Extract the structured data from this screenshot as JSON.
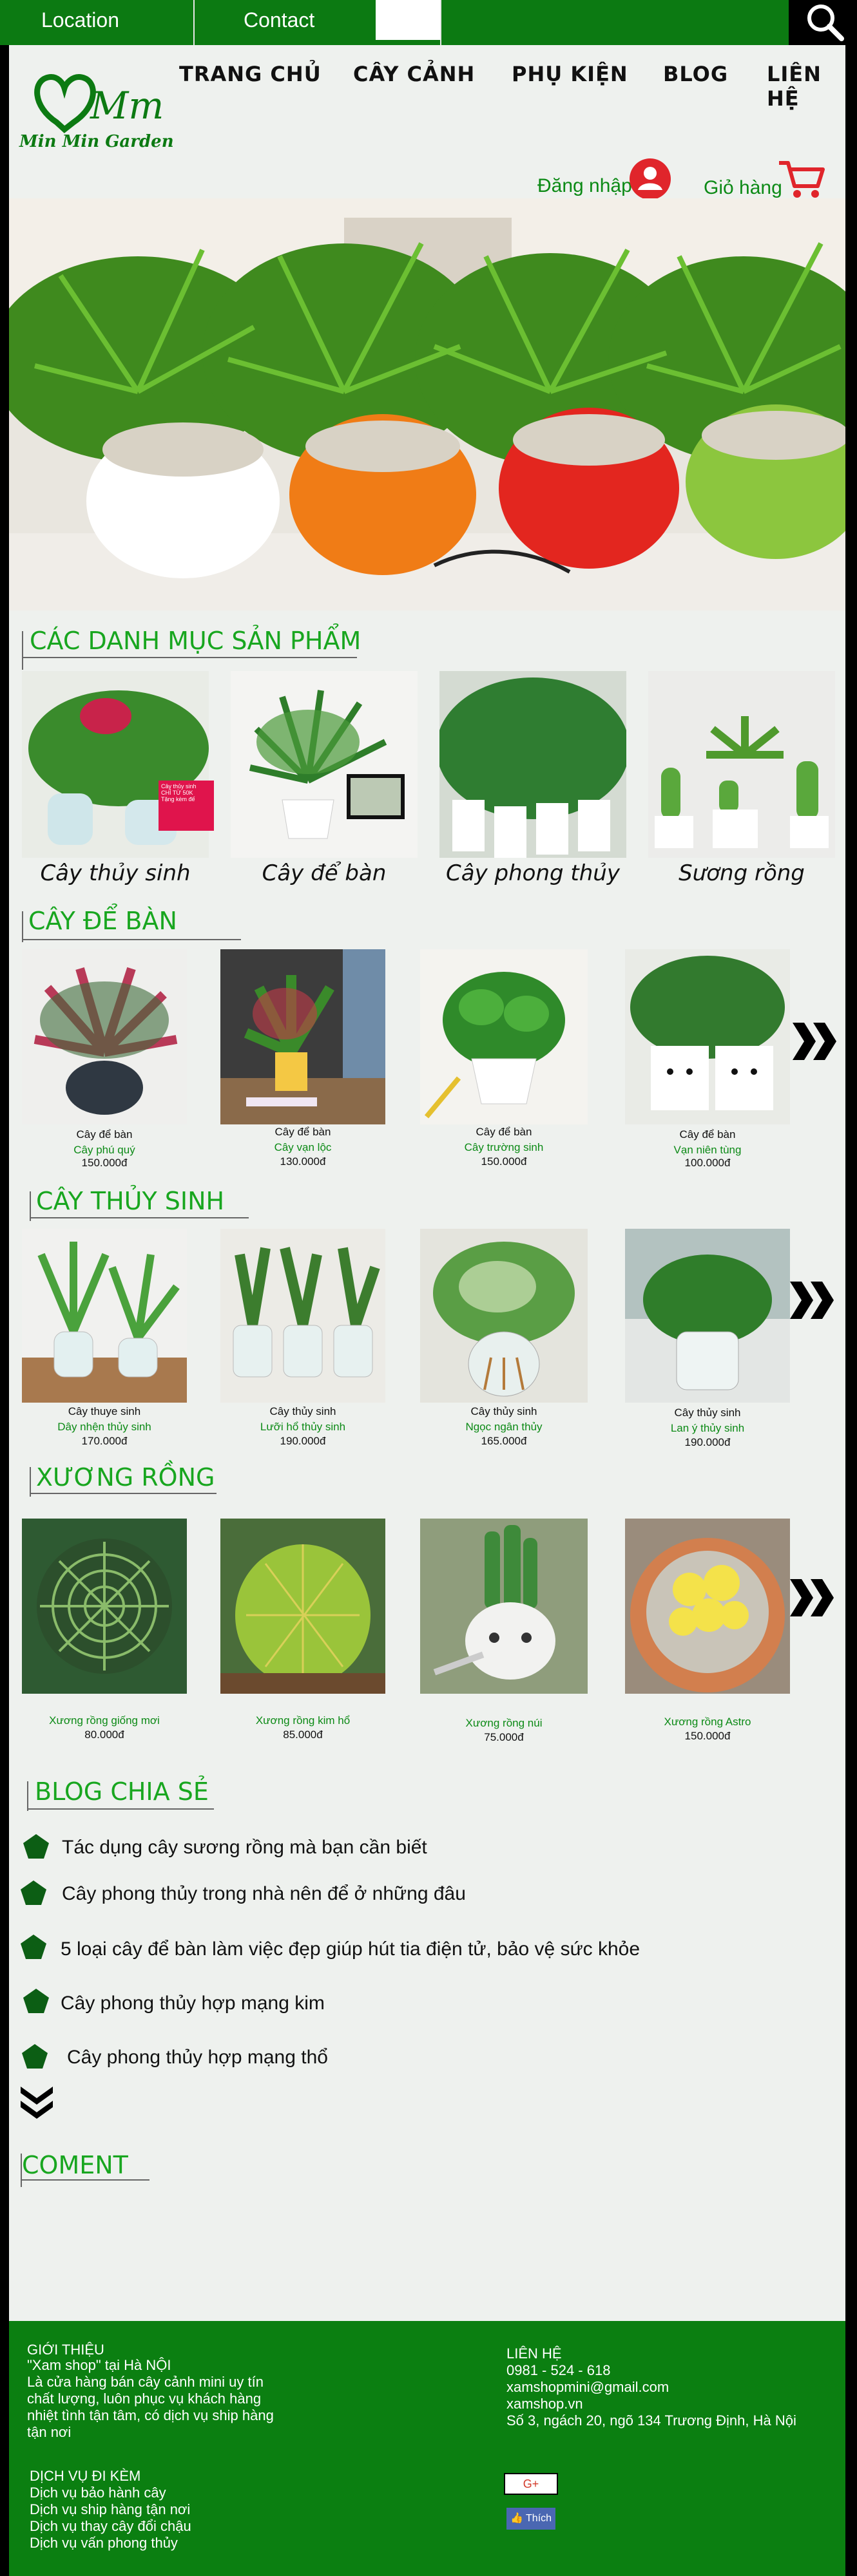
{
  "topbar": {
    "location_label": "Location",
    "contact_label": "Contact"
  },
  "brand": {
    "logo_mark": "Mm",
    "logo_text": "Min Min Garden"
  },
  "nav": {
    "home": "TRANG CHỦ",
    "plants": "CÂY CẢNH",
    "accessories": "PHỤ KIỆN",
    "blog": "BLOG",
    "contact": "LIÊN HỆ"
  },
  "user": {
    "login_label": "Đăng nhập",
    "cart_label": "Giỏ hàng"
  },
  "categories": {
    "title": "CÁC DANH MỤC SẢN PHẨM",
    "items": [
      {
        "label": "Cây thủy sinh",
        "badge": "Cây thủy sinh\nCHỈ TỪ 50K\nTặng kèm đế"
      },
      {
        "label": "Cây để bàn"
      },
      {
        "label": "Cây phong thủy"
      },
      {
        "label": "Sương rồng"
      }
    ]
  },
  "desk": {
    "title": "CÂY ĐỂ BÀN",
    "items": [
      {
        "type": "Cây để bàn",
        "name": "Cây phú quý",
        "price": "150.000đ"
      },
      {
        "type": "Cây để bàn",
        "name": "Cây vạn lộc",
        "price": "130.000đ"
      },
      {
        "type": "Cây để bàn",
        "name": "Cây trường sinh",
        "price": "150.000đ"
      },
      {
        "type": "Cây để bàn",
        "name": "Vạn niên tùng",
        "price": "100.000đ"
      }
    ]
  },
  "aquatic": {
    "title": "CÂY THỦY SINH",
    "items": [
      {
        "type": "Cây thuye sinh",
        "name": "Dây nhện thủy sinh",
        "price": "170.000đ"
      },
      {
        "type": "Cây thủy sinh",
        "name": "Lưỡi hổ thủy sinh",
        "price": "190.000đ"
      },
      {
        "type": "Cây thủy sinh",
        "name": "Ngọc ngân thủy",
        "price": "165.000đ"
      },
      {
        "type": "Cây thủy sinh",
        "name": "Lan ý thủy sinh",
        "price": "190.000đ"
      }
    ]
  },
  "cactus": {
    "title": "XƯƠNG RỒNG",
    "items": [
      {
        "name": "Xương rồng giống mơi",
        "price": "80.000đ"
      },
      {
        "name": "Xương rồng kim hổ",
        "price": "85.000đ"
      },
      {
        "name": "Xương rồng núi",
        "price": "75.000đ"
      },
      {
        "name": "Xương rồng Astro",
        "price": "150.000đ"
      }
    ]
  },
  "blog": {
    "title": "BLOG CHIA SẺ",
    "items": [
      "Tác dụng cây sương rồng mà bạn cần biết",
      "Cây phong thủy trong nhà nên để ở những đâu",
      "5 loại cây để bàn làm việc đẹp giúp hút tia điện tử, bảo vệ sức khỏe",
      "Cây phong thủy hợp mạng kim",
      "Cây phong thủy hợp mạng thổ"
    ]
  },
  "comment": {
    "title": "COMENT"
  },
  "footer": {
    "about_title": "GIỚI THIỆU",
    "about_line1": "\"Xam shop\" tại Hà NỘI",
    "about_line2": "Là cửa hàng bán cây cảnh mini uy tín",
    "about_line3": "chất lượng, luôn phục vụ khách hàng",
    "about_line4": "nhiệt tình tận tâm, có dịch vụ ship hàng",
    "about_line5": "tận nơi",
    "contact_title": "LIÊN HỆ",
    "phone": "0981 - 524 - 618",
    "email": "xamshopmini@gmail.com",
    "website": "xamshop.vn",
    "address": "Số 3, ngách 20, ngõ 134 Trương Định, Hà Nội",
    "services_title": "DỊCH VỤ ĐI KÈM",
    "service1": "Dịch vụ bảo hành cây",
    "service2": "Dịch vụ ship hàng tận nơi",
    "service3": "Dịch vụ thay cây đổi chậu",
    "service4": "Dịch vụ vấn phong thủy",
    "gplus_label": "G+",
    "like_label": "Thích"
  },
  "colors": {
    "brand_green": "#0c7a12",
    "accent_green": "#18a61f",
    "cart_red": "#e0252b"
  }
}
